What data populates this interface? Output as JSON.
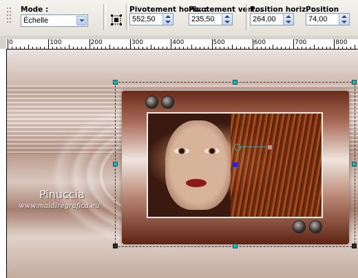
{
  "toolbar": {
    "mode_label": "Mode :",
    "mode_value": "Échelle",
    "pivot_h_label": "Pivotement horiz. :",
    "pivot_h_value": "552,50",
    "pivot_v_label": "Pivotement vert. :",
    "pivot_v_value": "235,50",
    "pos_h_label": "Position horiz. :",
    "pos_h_value": "264,00",
    "pos_v_label": "Position vert. :",
    "pos_v_value": "74,00"
  },
  "ruler": {
    "labels": [
      "0",
      "100",
      "200",
      "300",
      "400",
      "500",
      "600",
      "700",
      "800"
    ]
  },
  "canvas": {
    "watermark_name": "Pinuccia",
    "watermark_url": "www.maidiregrafica.eu"
  },
  "colors": {
    "handle": "#1fb3b3",
    "center_marker": "#2a1bff"
  }
}
